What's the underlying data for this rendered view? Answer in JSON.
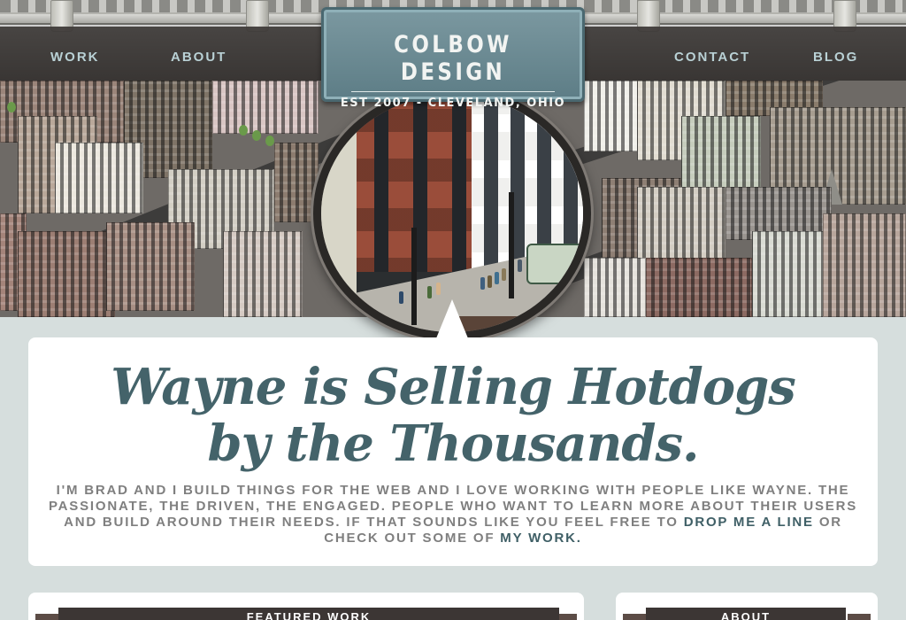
{
  "brand": {
    "title": "COLBOW DESIGN",
    "subtitle": "EST 2007  -  CLEVELAND, OHIO"
  },
  "nav": {
    "items": [
      {
        "label": "WORK"
      },
      {
        "label": "ABOUT"
      },
      {
        "label": "CONTACT"
      },
      {
        "label": "BLOG"
      }
    ]
  },
  "hero": {
    "headline": "Wayne is Selling Hotdogs by the Thousands.",
    "intro_text": "I'm Brad and I build things for the web and I love working with people like Wayne. The passionate, the driven, the engaged. People who want to learn more about their users and build around their needs. If that sounds like you feel free to",
    "drop_line_link": "drop me a line",
    "intro_middle": "or check out some of",
    "my_work_link": "my work."
  },
  "sections": {
    "featured_work": "FEATURED WORK",
    "about": "ABOUT"
  },
  "colors": {
    "accent": "#44636a",
    "nav_text": "#b9d1d5",
    "logo_bg": "#6b8a93",
    "nav_bg": "#3a3634"
  }
}
